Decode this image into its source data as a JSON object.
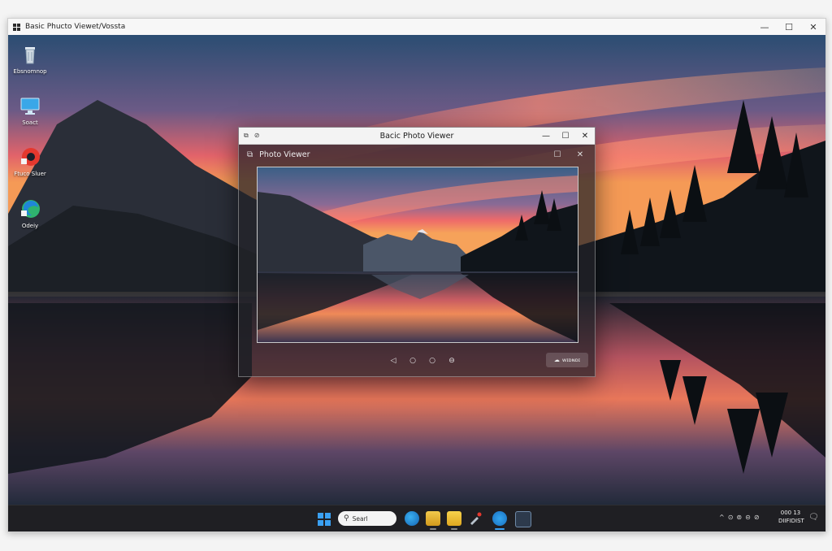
{
  "outer_window": {
    "title": "Basic Phucto Viewet/Vossta",
    "controls": {
      "minimize": "—",
      "maximize": "☐",
      "close": "✕"
    }
  },
  "desktop_icons": [
    {
      "label": "Ebsnomnop",
      "icon": "recycle-bin-icon"
    },
    {
      "label": "Soact",
      "icon": "monitor-icon"
    },
    {
      "label": "Ftuco Sluer",
      "icon": "red-app-icon"
    },
    {
      "label": "Odeiy",
      "icon": "edge-browser-icon"
    }
  ],
  "photo_viewer": {
    "title": "Bacic Photo Viewer",
    "app_name": "Photo Viewer",
    "titlebar_icons": {
      "left": "⧉",
      "right": "⊘"
    },
    "controls": {
      "minimize": "—",
      "maximize": "☐",
      "close": "✕"
    },
    "inner_controls": {
      "maximize": "☐",
      "close": "✕"
    },
    "nav": {
      "prev": "◁",
      "play": "○",
      "next": "○",
      "rotate": "⊖"
    },
    "action_button": {
      "icon": "☁",
      "label": "ᴡɪᴅɴᴅɪ"
    }
  },
  "taskbar": {
    "search_placeholder": "Searl",
    "tray_icons": [
      "^",
      "⊙",
      "⊚",
      "⊝",
      "⊘"
    ],
    "clock_time": "000 13",
    "clock_date": "DIIFIDIST",
    "colors": {
      "accent": "#3aa0f2",
      "bg": "#1f1f23"
    }
  }
}
